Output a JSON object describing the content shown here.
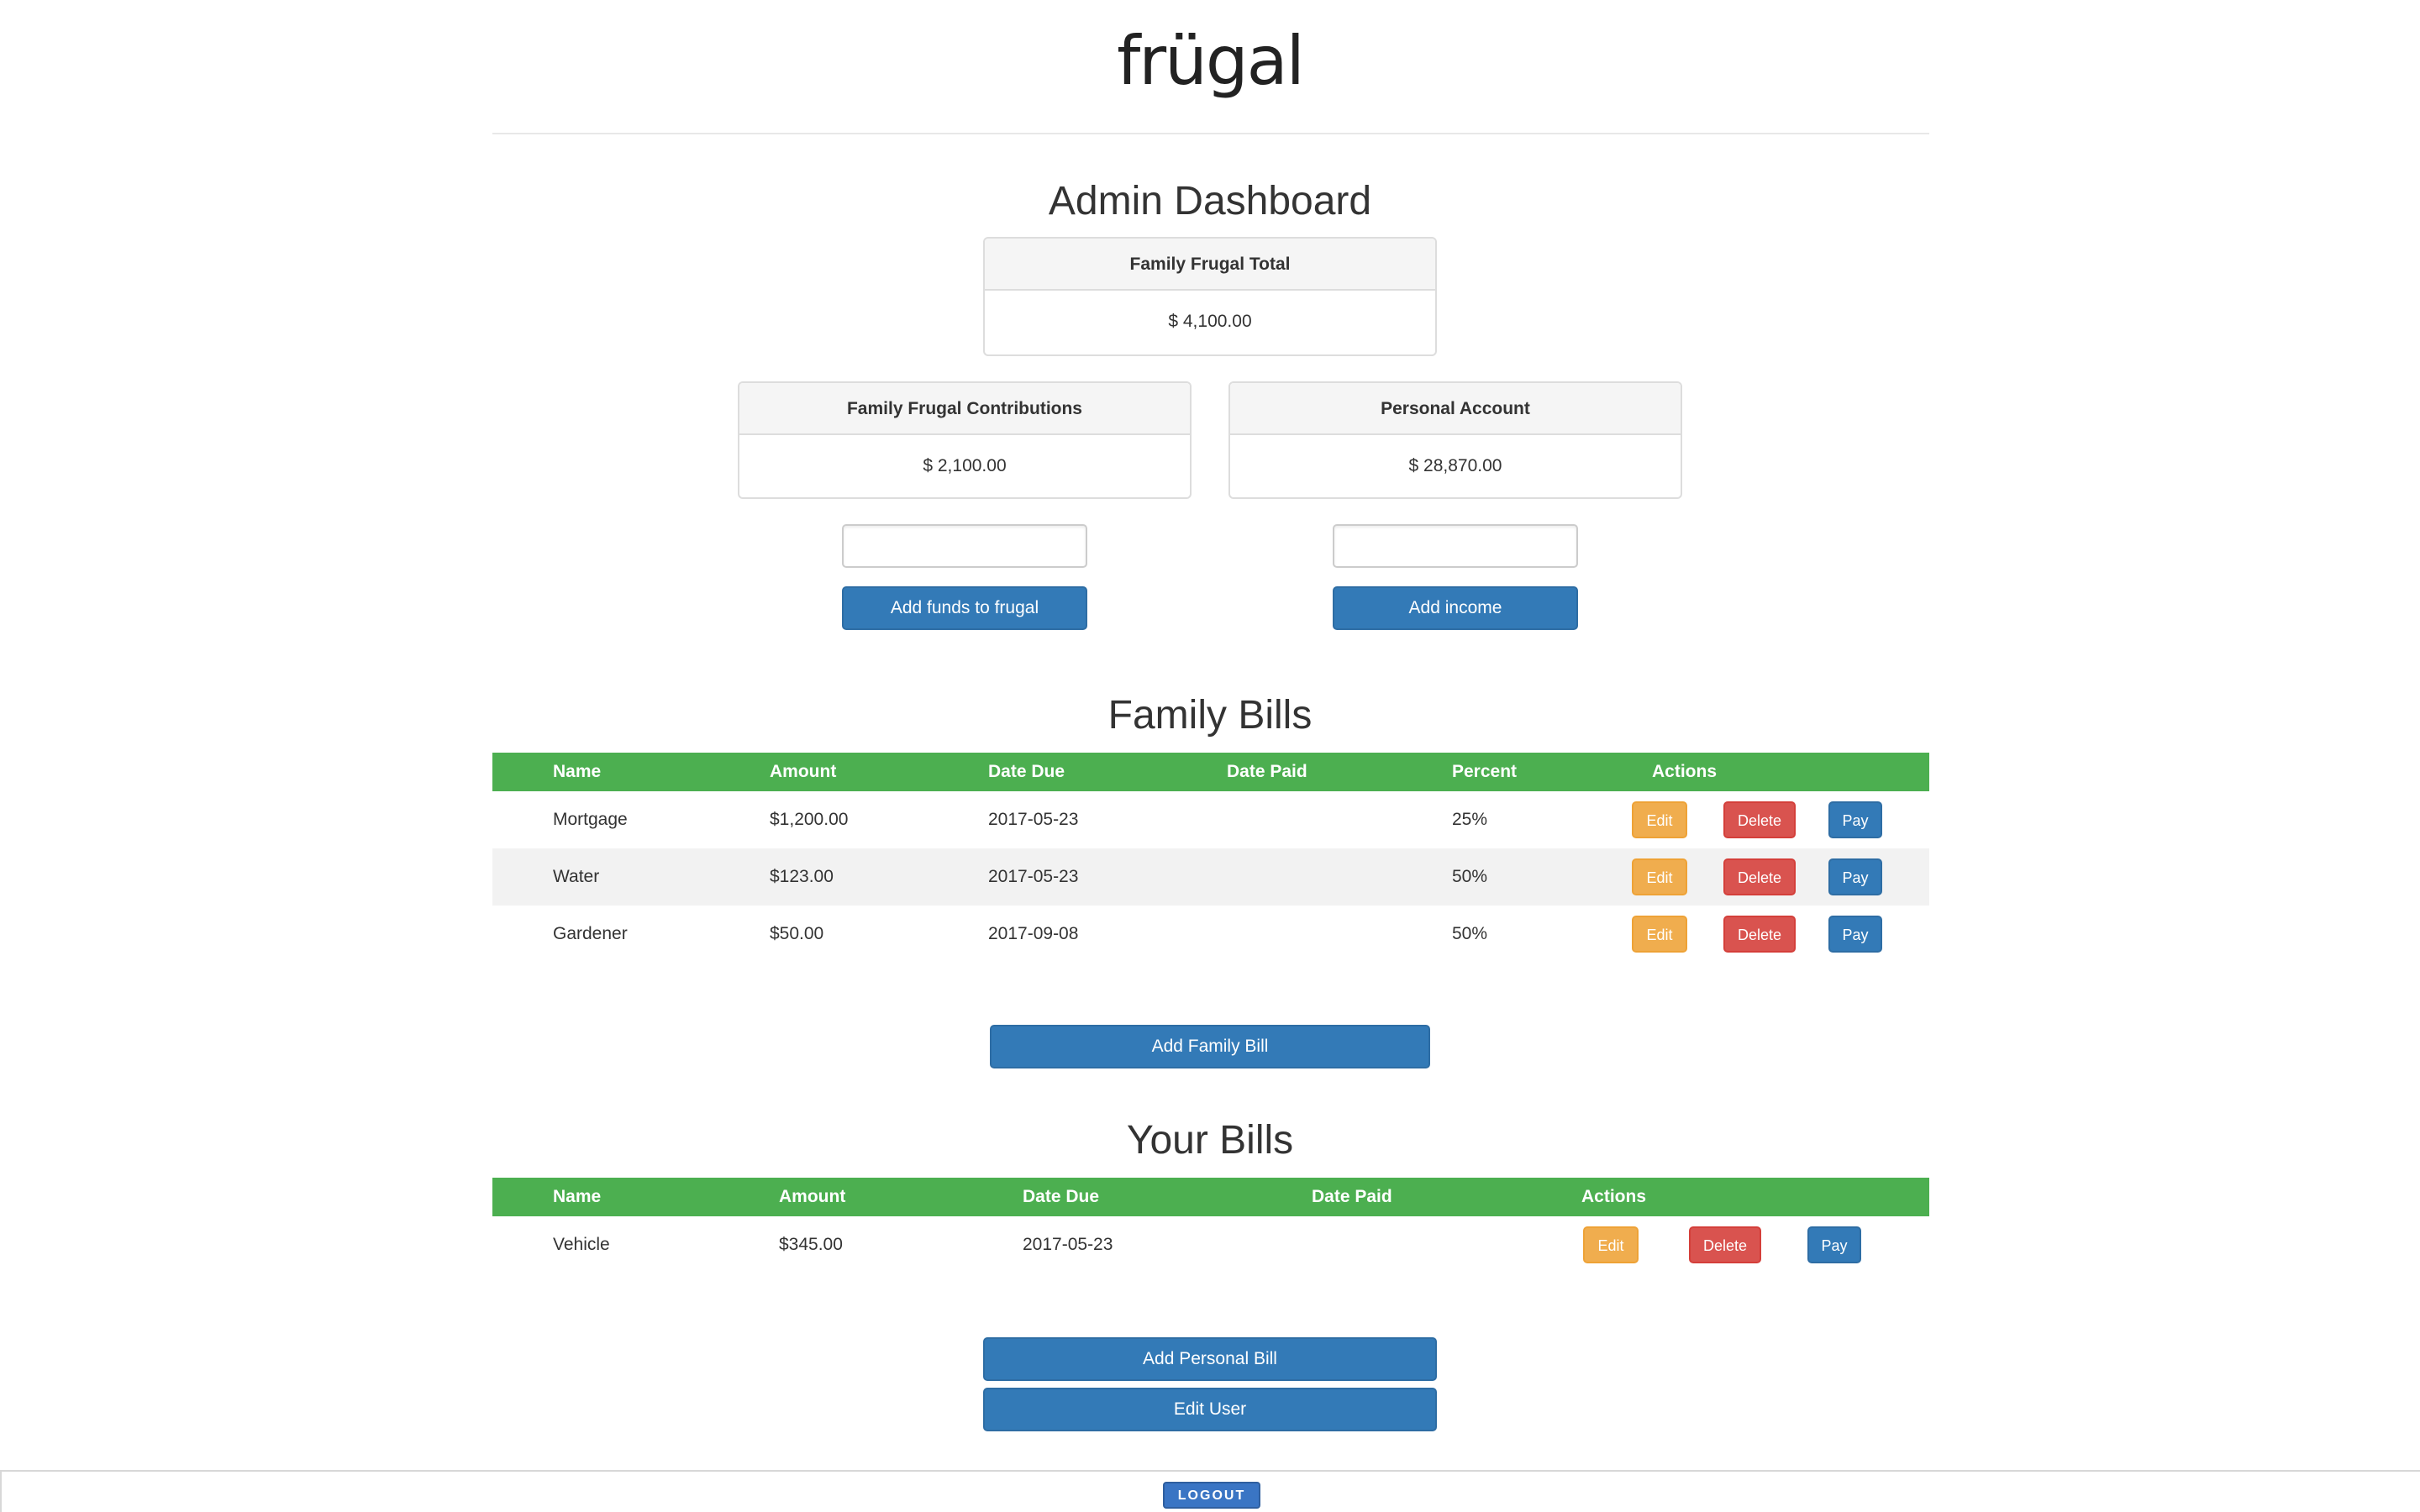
{
  "brand": {
    "logo_text": "frügal"
  },
  "dashboard": {
    "title": "Admin Dashboard",
    "total_panel": {
      "label": "Family Frugal Total",
      "value": "$ 4,100.00"
    },
    "contributions_panel": {
      "label": "Family Frugal Contributions",
      "value": "$ 2,100.00"
    },
    "personal_panel": {
      "label": "Personal Account",
      "value": "$ 28,870.00"
    },
    "contributions_input": {
      "value": "",
      "placeholder": ""
    },
    "income_input": {
      "value": "",
      "placeholder": ""
    },
    "add_funds_label": "Add funds to frugal",
    "add_income_label": "Add income"
  },
  "family_bills": {
    "title": "Family Bills",
    "columns": [
      "Name",
      "Amount",
      "Date Due",
      "Date Paid",
      "Percent",
      "Actions"
    ],
    "rows": [
      {
        "name": "Mortgage",
        "amount": "$1,200.00",
        "date_due": "2017-05-23",
        "date_paid": "",
        "percent": "25%"
      },
      {
        "name": "Water",
        "amount": "$123.00",
        "date_due": "2017-05-23",
        "date_paid": "",
        "percent": "50%"
      },
      {
        "name": "Gardener",
        "amount": "$50.00",
        "date_due": "2017-09-08",
        "date_paid": "",
        "percent": "50%"
      }
    ],
    "add_label": "Add Family Bill"
  },
  "your_bills": {
    "title": "Your Bills",
    "columns": [
      "Name",
      "Amount",
      "Date Due",
      "Date Paid",
      "Actions"
    ],
    "rows": [
      {
        "name": "Vehicle",
        "amount": "$345.00",
        "date_due": "2017-05-23",
        "date_paid": ""
      }
    ],
    "add_label": "Add Personal Bill",
    "edit_user_label": "Edit User"
  },
  "actions": {
    "edit": "Edit",
    "delete": "Delete",
    "pay": "Pay"
  },
  "footer": {
    "logout_label": "LOGOUT"
  },
  "colors": {
    "table_header": "#4caf50",
    "primary": "#337ab7",
    "warning": "#f0ad4e",
    "danger": "#d9534f"
  }
}
